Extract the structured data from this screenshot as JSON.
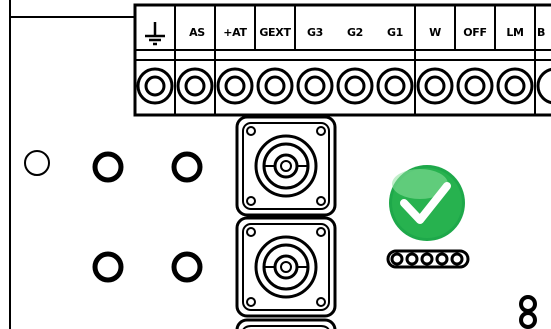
{
  "terminal_block": {
    "labels": [
      "AS",
      "+AT",
      "GEXT",
      "G3",
      "G2",
      "G1",
      "W",
      "OFF",
      "LM",
      "B"
    ],
    "ground_icon": "ground-icon",
    "screw_icon": "screw-terminal-icon"
  },
  "status": {
    "icon": "checkmark-icon",
    "color": "#1ea84a"
  },
  "colors": {
    "outline": "#000000",
    "background": "#ffffff",
    "status_green": "#1ea84a"
  }
}
